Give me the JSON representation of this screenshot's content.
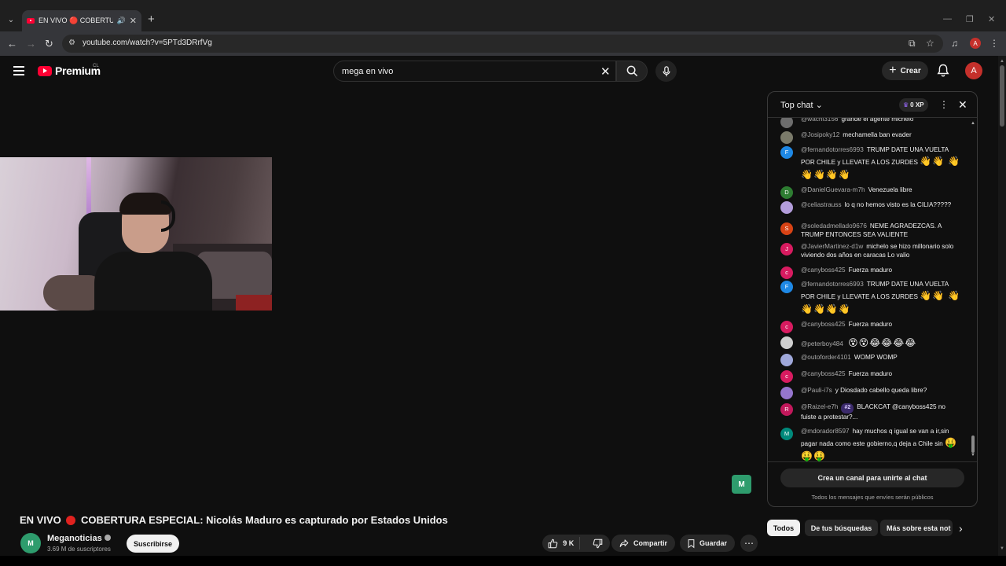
{
  "browser": {
    "tab_title": "EN VIVO 🔴 COBERTURA ES",
    "url": "youtube.com/watch?v=5PTd3DRrfVg",
    "profile_initial": "A"
  },
  "header": {
    "logo_text": "Premium",
    "country_code": "CL",
    "search_query": "mega en vivo",
    "create_label": "Crear",
    "avatar_initial": "A"
  },
  "video": {
    "title_prefix": "EN VIVO",
    "title_rest": "COBERTURA ESPECIAL: Nicolás Maduro es capturado por Estados Unidos",
    "channel_name": "Meganoticias",
    "subscribers": "3.69 M de suscriptores",
    "subscribe_label": "Suscribirse",
    "likes": "9 K",
    "share_label": "Compartir",
    "save_label": "Guardar"
  },
  "chat": {
    "title": "Top chat",
    "xp": "0 XP",
    "create_channel_label": "Crea un canal para unirte al chat",
    "public_note": "Todos los mensajes que envíes serán públicos",
    "messages": [
      {
        "author": "@wachi3156",
        "text": "grande el agente michelo",
        "initial": "",
        "color": "#6d6d6d"
      },
      {
        "author": "@Josipoky12",
        "text": "mechamella ban evader",
        "initial": "",
        "color": "#7a7a6a"
      },
      {
        "author": "@fernandotorres6993",
        "text": "TRUMP DATE UNA VUELTA POR CHILE y LLEVATE A LOS ZURDES",
        "emojis": "👋👋 👋👋👋👋👋",
        "initial": "F",
        "color": "#1e88e5"
      },
      {
        "author": "@DanielGuevara-m7h",
        "text": "Venezuela libre",
        "initial": "D",
        "color": "#2e7d32"
      },
      {
        "author": "@celiastrauss",
        "text": "lo q no hemos visto es la CILIA?????",
        "initial": "",
        "color": "#b39ddb"
      },
      {
        "author": "@soledadmellado9676",
        "text": "NEME AGRADEZCAS. A TRUMP ENTONCES SEA VALIENTE",
        "initial": "S",
        "color": "#d84315"
      },
      {
        "author": "@JavierMartinez-d1w",
        "text": "michelo se hizo millonario solo viviendo dos años en caracas Lo valio",
        "initial": "J",
        "color": "#d81b60"
      },
      {
        "author": "@canyboss425",
        "text": "Fuerza maduro",
        "initial": "c",
        "color": "#d81b60"
      },
      {
        "author": "@fernandotorres6993",
        "text": "TRUMP DATE UNA VUELTA POR CHILE y LLEVATE A LOS ZURDES",
        "emojis": "👋👋 👋👋👋👋👋",
        "initial": "F",
        "color": "#1e88e5"
      },
      {
        "author": "@canyboss425",
        "text": "Fuerza maduro",
        "initial": "c",
        "color": "#d81b60"
      },
      {
        "author": "@peterboy484",
        "text": "",
        "emojis": "😵😵😂😂😂😂",
        "initial": "",
        "color": "#cfcfcf"
      },
      {
        "author": "@outoforder4101",
        "text": "WOMP WOMP",
        "initial": "",
        "color": "#9fa8da"
      },
      {
        "author": "@canyboss425",
        "text": "Fuerza maduro",
        "initial": "c",
        "color": "#d81b60"
      },
      {
        "author": "@Pauli-i7s",
        "text": "y Diosdado cabello queda libre?",
        "initial": "",
        "color": "#9575cd"
      },
      {
        "author": "@Raizel-e7h",
        "badge": "#2",
        "text": "BLACKCAT @canyboss425 no fuiste a protestar?...",
        "initial": "R",
        "color": "#c2185b"
      },
      {
        "author": "@mdorador8597",
        "text": "hay muchos q igual se van a ir,sin pagar nada como este gobierno,q deja a Chile sin",
        "emojis": "🤑🤑🤑",
        "initial": "M",
        "color": "#00897b"
      }
    ]
  },
  "chips": {
    "all": "Todos",
    "searches": "De tus búsquedas",
    "more": "Más sobre esta not"
  },
  "watermark": "M"
}
